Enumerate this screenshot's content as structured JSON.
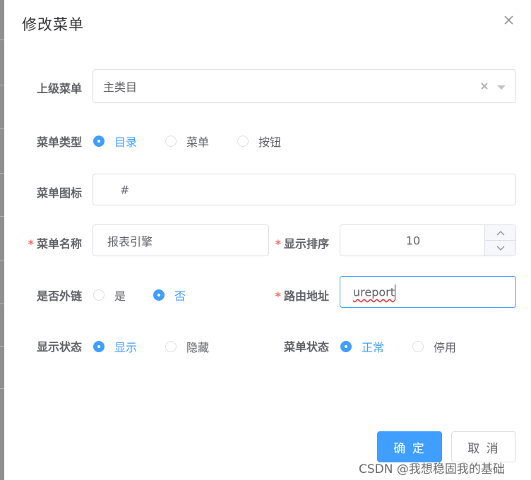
{
  "dialog": {
    "title": "修改菜单",
    "close_icon": "close-icon"
  },
  "form": {
    "parent_menu": {
      "label": "上级菜单",
      "value": "主类目"
    },
    "menu_type": {
      "label": "菜单类型",
      "options": [
        "目录",
        "菜单",
        "按钮"
      ],
      "selected": "目录"
    },
    "menu_icon": {
      "label": "菜单图标",
      "value": "#"
    },
    "menu_name": {
      "label": "菜单名称",
      "required": "*",
      "value": "报表引擎"
    },
    "display_order": {
      "label": "显示排序",
      "required": "*",
      "value": "10"
    },
    "is_external": {
      "label": "是否外链",
      "options": [
        "是",
        "否"
      ],
      "selected": "否"
    },
    "route_path": {
      "label": "路由地址",
      "required": "*",
      "value": "ureport"
    },
    "visible_status": {
      "label": "显示状态",
      "options": [
        "显示",
        "隐藏"
      ],
      "selected": "显示"
    },
    "menu_status": {
      "label": "菜单状态",
      "options": [
        "正常",
        "停用"
      ],
      "selected": "正常"
    }
  },
  "footer": {
    "confirm_label": "确 定",
    "cancel_label": "取 消"
  },
  "watermark": "CSDN @我想稳固我的基础",
  "colors": {
    "primary": "#409eff",
    "required": "#f56c6c",
    "border": "#dcdfe6",
    "text": "#606266"
  }
}
